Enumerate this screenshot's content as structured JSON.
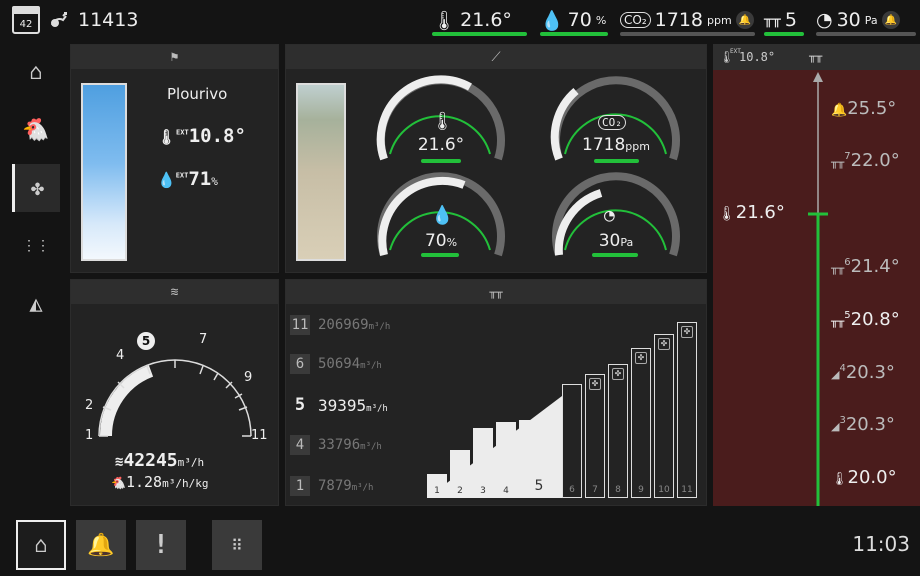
{
  "header": {
    "day": "42",
    "bird_count": "11413",
    "temperature": "21.6°",
    "humidity": "70",
    "humidity_unit": "%",
    "co2": "1718",
    "co2_unit": "ppm",
    "ventilation_level": "5",
    "pressure": "30",
    "pressure_unit": "Pa"
  },
  "outdoor": {
    "location": "Plourivo",
    "ext_temp": "10.8°",
    "ext_humidity": "71",
    "ext_humidity_unit": "%",
    "ext_label": "EXT"
  },
  "gauges": {
    "temperature": {
      "value": "21.6°"
    },
    "co2": {
      "value": "1718",
      "unit": "ppm"
    },
    "humidity": {
      "value": "70",
      "unit": "%"
    },
    "pressure": {
      "value": "30",
      "unit": "Pa"
    }
  },
  "speedometer": {
    "ticks": [
      "1",
      "2",
      "4",
      "5",
      "7",
      "9",
      "11"
    ],
    "current": "5",
    "airflow": "42245",
    "airflow_unit": "m³/h",
    "per_kg": "1.28",
    "per_kg_unit": "m³/h/kg"
  },
  "vent_table": [
    {
      "stage": "11",
      "value": "206969",
      "unit": "m³/h",
      "active": false
    },
    {
      "stage": "6",
      "value": "50694",
      "unit": "m³/h",
      "active": false
    },
    {
      "stage": "5",
      "value": "39395",
      "unit": "m³/h",
      "active": true
    },
    {
      "stage": "4",
      "value": "33796",
      "unit": "m³/h",
      "active": false
    },
    {
      "stage": "1",
      "value": "7879",
      "unit": "m³/h",
      "active": false
    }
  ],
  "fan_levels": [
    "1",
    "2",
    "3",
    "4",
    "5",
    "6",
    "7",
    "8",
    "9",
    "10",
    "11"
  ],
  "temp_curve": {
    "ext_label": "EXT",
    "ext_value": "10.8°",
    "current": "21.6°",
    "levels": [
      {
        "sup": "",
        "value": "25.5°"
      },
      {
        "sup": "7",
        "value": "22.0°"
      },
      {
        "sup": "6",
        "value": "21.4°"
      },
      {
        "sup": "5",
        "value": "20.8°"
      },
      {
        "sup": "4",
        "value": "20.3°"
      },
      {
        "sup": "3",
        "value": "20.3°"
      },
      {
        "sup": "",
        "value": "20.0°"
      }
    ]
  },
  "footer": {
    "time": "11:03"
  }
}
